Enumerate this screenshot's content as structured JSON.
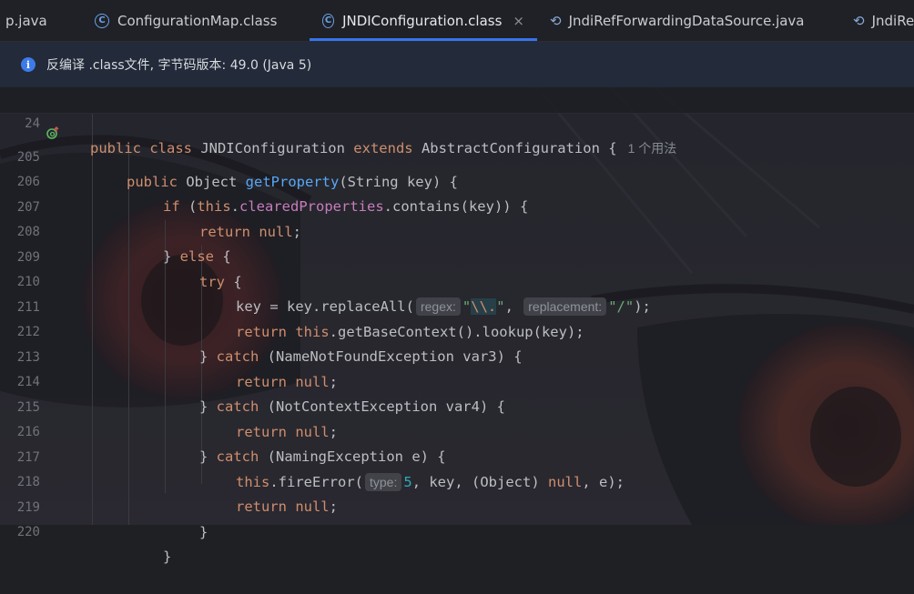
{
  "tabs": [
    {
      "label": "p.java",
      "icon": "none",
      "active": false
    },
    {
      "label": "ConfigurationMap.class",
      "icon": "class-icon",
      "active": false
    },
    {
      "label": "JNDIConfiguration.class",
      "icon": "class-icon",
      "active": true,
      "close": "×"
    },
    {
      "label": "JndiRefForwardingDataSource.java",
      "icon": "java-class-icon",
      "active": false
    },
    {
      "label": "JndiRe",
      "icon": "java-class-icon",
      "active": false
    }
  ],
  "banner": {
    "icon": "info-icon",
    "text": "反编译 .class文件, 字节码版本: 49.0 (Java 5)"
  },
  "sticky": {
    "line_no": "24",
    "usages": "1 个用法"
  },
  "lines": [
    {
      "no": "205"
    },
    {
      "no": "206"
    },
    {
      "no": "207"
    },
    {
      "no": "208"
    },
    {
      "no": "209"
    },
    {
      "no": "210"
    },
    {
      "no": "211"
    },
    {
      "no": "212"
    },
    {
      "no": "213"
    },
    {
      "no": "214"
    },
    {
      "no": "215"
    },
    {
      "no": "216"
    },
    {
      "no": "217"
    },
    {
      "no": "218"
    },
    {
      "no": "219"
    },
    {
      "no": "220"
    }
  ],
  "hints": {
    "regex": "regex:",
    "replacement": "replacement:",
    "type": "type:"
  },
  "colors": {
    "keyword": "#cf8e6d",
    "method": "#56a8f5",
    "field": "#c77dbb",
    "string": "#6aab73",
    "number": "#2aacb8",
    "accent": "#3574f0"
  }
}
